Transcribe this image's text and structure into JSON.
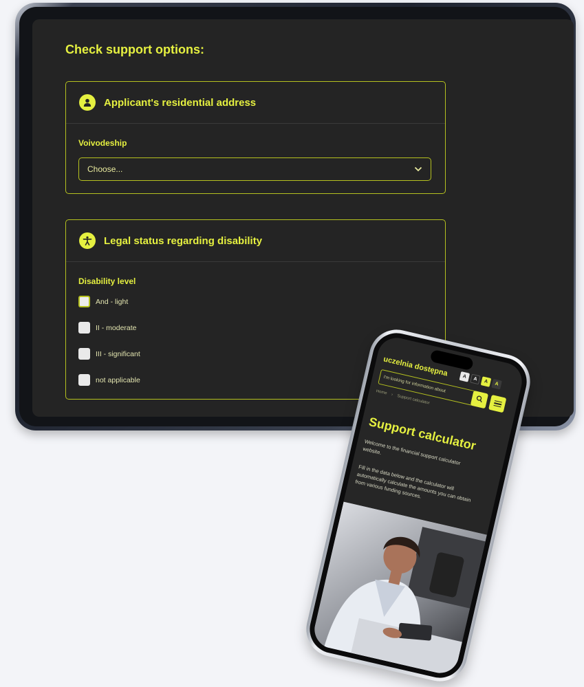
{
  "tablet": {
    "heading": "Check support options:",
    "address_card": {
      "title": "Applicant's residential address",
      "icon": "user-icon",
      "field_label": "Voivodeship",
      "select_value": "Choose..."
    },
    "disability_card": {
      "title": "Legal status regarding disability",
      "icon": "accessibility-icon",
      "field_label": "Disability level",
      "options": [
        "And - light",
        "II - moderate",
        "III - significant",
        "not applicable"
      ]
    }
  },
  "phone": {
    "logo": "uczelnia dostępna",
    "contrast_buttons": [
      "A",
      "A",
      "A",
      "A"
    ],
    "search_placeholder": "I'm looking for information about",
    "breadcrumb": [
      "Home",
      "Support calculator"
    ],
    "title": "Support calculator",
    "intro": "Welcome to the financial support calculator website.",
    "instructions": "Fill in the data below and the calculator will automatically calculate the amounts you can obtain from various funding sources."
  },
  "colors": {
    "accent": "#e5f040",
    "background": "#242424",
    "page": "#f3f4f8"
  }
}
